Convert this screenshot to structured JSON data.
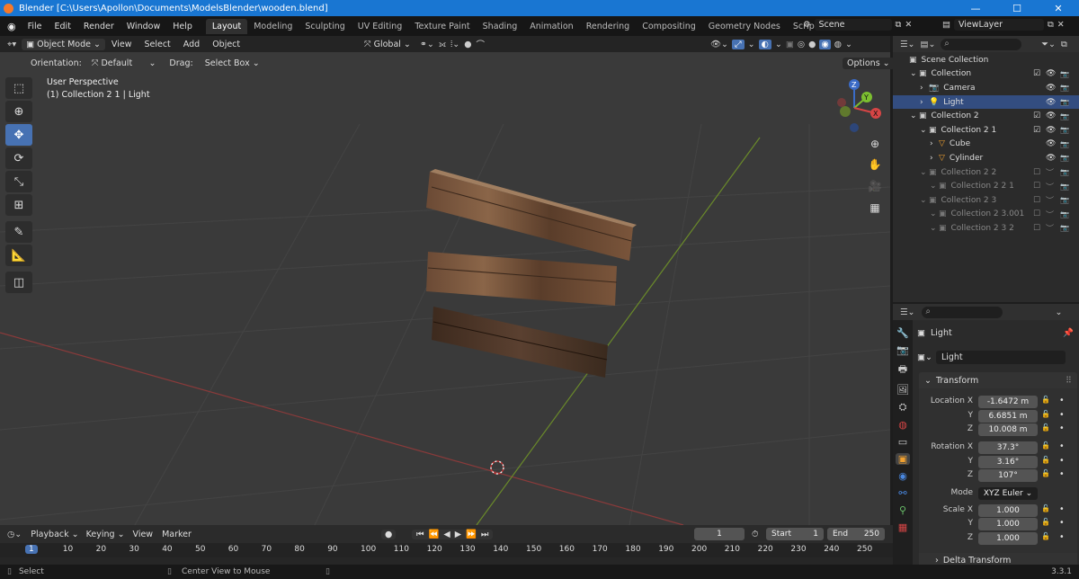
{
  "window": {
    "title": "Blender [C:\\Users\\Apollon\\Documents\\ModelsBlender\\wooden.blend]"
  },
  "menus": [
    "File",
    "Edit",
    "Render",
    "Window",
    "Help"
  ],
  "workspaces": [
    "Layout",
    "Modeling",
    "Sculpting",
    "UV Editing",
    "Texture Paint",
    "Shading",
    "Animation",
    "Rendering",
    "Compositing",
    "Geometry Nodes",
    "Scripting"
  ],
  "scene": {
    "name": "Scene",
    "view_layer": "ViewLayer"
  },
  "viewport": {
    "mode": "Object Mode",
    "view_menu": [
      "View",
      "Select",
      "Add",
      "Object"
    ],
    "orientation_label": "Orientation:",
    "orientation": "Default",
    "drag_label": "Drag:",
    "drag": "Select Box",
    "transform_space": "Global",
    "options": "Options",
    "overlay_line1": "User Perspective",
    "overlay_line2": "(1) Collection 2 1 | Light",
    "gizmo_axes": [
      "Z",
      "Y",
      "X"
    ]
  },
  "outliner": {
    "rows": [
      {
        "label": "Scene Collection",
        "depth": 0,
        "sel": false,
        "dim": false
      },
      {
        "label": "Collection",
        "depth": 1,
        "sel": false,
        "dim": false
      },
      {
        "label": "Camera",
        "depth": 2,
        "sel": false,
        "dim": false
      },
      {
        "label": "Light",
        "depth": 2,
        "sel": true,
        "dim": false
      },
      {
        "label": "Collection 2",
        "depth": 1,
        "sel": false,
        "dim": false
      },
      {
        "label": "Collection 2 1",
        "depth": 2,
        "sel": false,
        "dim": false
      },
      {
        "label": "Cube",
        "depth": 3,
        "sel": false,
        "dim": false
      },
      {
        "label": "Cylinder",
        "depth": 3,
        "sel": false,
        "dim": false
      },
      {
        "label": "Collection 2 2",
        "depth": 2,
        "sel": false,
        "dim": true
      },
      {
        "label": "Collection 2 2 1",
        "depth": 3,
        "sel": false,
        "dim": true
      },
      {
        "label": "Collection 2 3",
        "depth": 2,
        "sel": false,
        "dim": true
      },
      {
        "label": "Collection 2 3.001",
        "depth": 3,
        "sel": false,
        "dim": true
      },
      {
        "label": "Collection 2 3 2",
        "depth": 3,
        "sel": false,
        "dim": true
      }
    ]
  },
  "properties": {
    "object_name": "Light",
    "datablock": "Light",
    "panel": "Transform",
    "location_label": "Location X",
    "loc_x": "-1.6472 m",
    "loc_y": "6.6851 m",
    "loc_z": "10.008 m",
    "rotation_label": "Rotation X",
    "rot_x": "37.3°",
    "rot_y": "3.16°",
    "rot_z": "107°",
    "mode_label": "Mode",
    "mode": "XYZ Euler",
    "scale_label": "Scale X",
    "scale_x": "1.000",
    "scale_y": "1.000",
    "scale_z": "1.000",
    "y": "Y",
    "z": "Z",
    "delta": "Delta Transform"
  },
  "timeline": {
    "menus": [
      "Playback",
      "Keying",
      "View",
      "Marker"
    ],
    "current_frame": "1",
    "start_label": "Start",
    "start": "1",
    "end_label": "End",
    "end": "250",
    "ticks": [
      "1",
      "10",
      "20",
      "30",
      "40",
      "50",
      "60",
      "70",
      "80",
      "90",
      "100",
      "110",
      "120",
      "130",
      "140",
      "150",
      "160",
      "170",
      "180",
      "190",
      "200",
      "210",
      "220",
      "230",
      "240",
      "250"
    ]
  },
  "status": {
    "left": "Select",
    "center": "Center View to Mouse",
    "version": "3.3.1"
  }
}
